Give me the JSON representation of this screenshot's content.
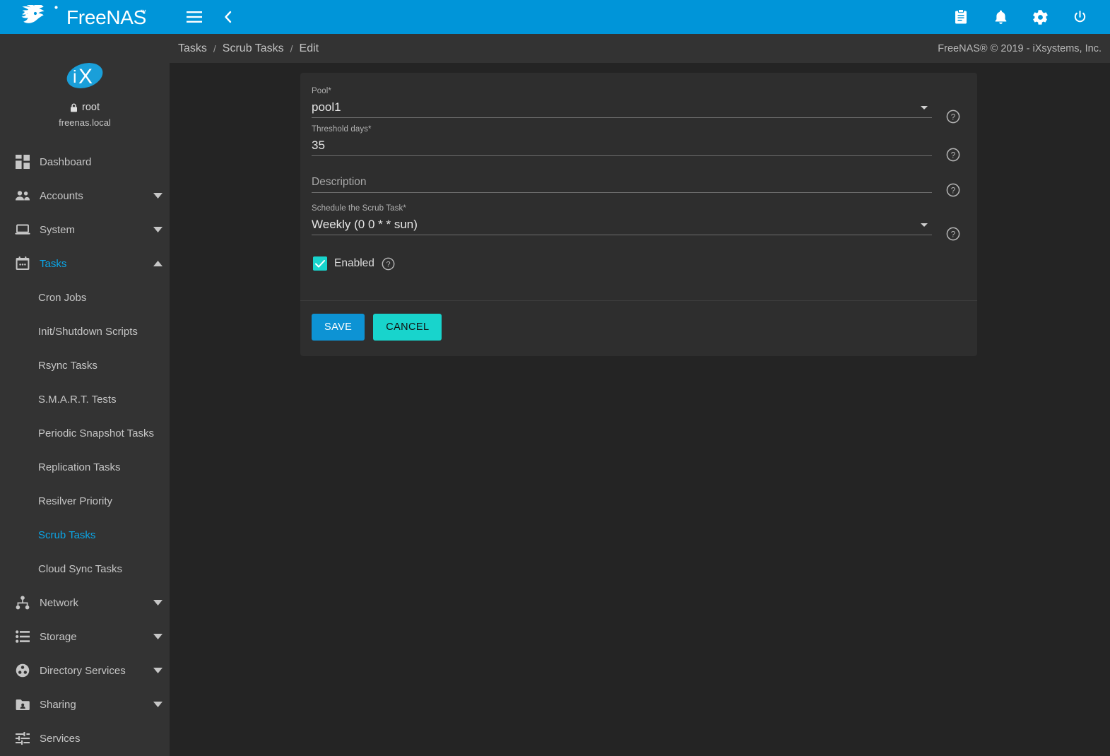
{
  "topbar": {
    "brand": "FreeNAS",
    "menu_icon": "hamburger-menu-icon",
    "back_icon": "chevron-left-icon",
    "actions": [
      {
        "name": "tasks-manager-icon",
        "label": "Tasks"
      },
      {
        "name": "notifications-bell-icon",
        "label": "Alerts"
      },
      {
        "name": "settings-gear-icon",
        "label": "Settings"
      },
      {
        "name": "power-icon",
        "label": "Power"
      }
    ]
  },
  "sidebar": {
    "user": {
      "name": "root",
      "host": "freenas.local",
      "lock_icon": "lock-icon",
      "logo": "ix-systems-logo"
    },
    "items": [
      {
        "label": "Dashboard",
        "icon": "dashboard-icon",
        "expandable": false,
        "active": false
      },
      {
        "label": "Accounts",
        "icon": "accounts-people-icon",
        "expandable": true,
        "active": false
      },
      {
        "label": "System",
        "icon": "system-laptop-icon",
        "expandable": true,
        "active": false
      },
      {
        "label": "Tasks",
        "icon": "tasks-calendar-icon",
        "expandable": true,
        "active": true,
        "expanded": true
      }
    ],
    "tasks_children": [
      {
        "label": "Cron Jobs",
        "active": false
      },
      {
        "label": "Init/Shutdown Scripts",
        "active": false
      },
      {
        "label": "Rsync Tasks",
        "active": false
      },
      {
        "label": "S.M.A.R.T. Tests",
        "active": false
      },
      {
        "label": "Periodic Snapshot Tasks",
        "active": false
      },
      {
        "label": "Replication Tasks",
        "active": false
      },
      {
        "label": "Resilver Priority",
        "active": false
      },
      {
        "label": "Scrub Tasks",
        "active": true
      },
      {
        "label": "Cloud Sync Tasks",
        "active": false
      }
    ],
    "items_after": [
      {
        "label": "Network",
        "icon": "network-icon",
        "expandable": true,
        "active": false
      },
      {
        "label": "Storage",
        "icon": "storage-list-icon",
        "expandable": true,
        "active": false
      },
      {
        "label": "Directory Services",
        "icon": "directory-services-icon",
        "expandable": true,
        "active": false
      },
      {
        "label": "Sharing",
        "icon": "sharing-folder-icon",
        "expandable": true,
        "active": false
      },
      {
        "label": "Services",
        "icon": "services-sliders-icon",
        "expandable": false,
        "active": false
      }
    ]
  },
  "breadcrumb": {
    "items": [
      "Tasks",
      "Scrub Tasks",
      "Edit"
    ],
    "separator": "/",
    "copyright": "FreeNAS® © 2019 - iXsystems, Inc."
  },
  "form": {
    "fields": {
      "pool": {
        "label": "Pool",
        "required_marker": "*",
        "value": "pool1",
        "type": "select",
        "help_icon": "help-circle-icon"
      },
      "threshold_days": {
        "label": "Threshold days",
        "required_marker": "*",
        "value": "35",
        "type": "text",
        "help_icon": "help-circle-icon"
      },
      "description": {
        "label": "",
        "placeholder": "Description",
        "value": "",
        "type": "text",
        "help_icon": "help-circle-icon"
      },
      "schedule": {
        "label": "Schedule the Scrub Task",
        "required_marker": "*",
        "value": "Weekly (0 0 * * sun)",
        "type": "select",
        "help_icon": "help-circle-icon"
      }
    },
    "enabled": {
      "label": "Enabled",
      "checked": true,
      "help_icon": "help-circle-icon",
      "check_icon": "checkmark-icon"
    },
    "buttons": {
      "save": "SAVE",
      "cancel": "CANCEL"
    }
  },
  "colors": {
    "accent_blue": "#0095d9",
    "link_blue": "#0aa6e8",
    "teal": "#18d4cc",
    "save_blue": "#0d93d4",
    "sidebar_bg": "#333333",
    "content_bg": "#242424",
    "card_bg": "#2e2e2e"
  }
}
